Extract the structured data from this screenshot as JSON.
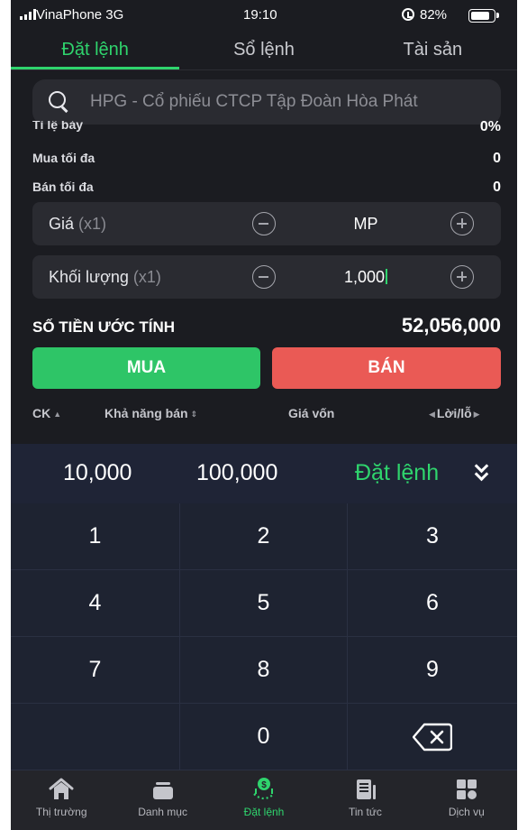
{
  "status_bar": {
    "carrier": "VinaPhone 3G",
    "time": "19:10",
    "battery_text": "82%",
    "battery_level": 0.82
  },
  "tabs": [
    {
      "label": "Đặt lệnh",
      "active": true
    },
    {
      "label": "Sổ lệnh",
      "active": false
    },
    {
      "label": "Tài sản",
      "active": false
    }
  ],
  "search": {
    "placeholder": "HPG - Cổ phiếu CTCP Tập Đoàn Hòa Phát",
    "icon": "search-icon"
  },
  "info_rows": [
    {
      "label": "Tỉ lệ bảy",
      "value": "0%"
    },
    {
      "label": "Mua tối đa",
      "value": "0"
    },
    {
      "label": "Bán tối đa",
      "value": "0"
    }
  ],
  "price_field": {
    "label": "Giá",
    "multiplier": "(x1)",
    "value": "MP"
  },
  "volume_field": {
    "label": "Khối lượng",
    "multiplier": "(x1)",
    "value": "1,000"
  },
  "estimate": {
    "label": "SỐ TIỀN ƯỚC TÍNH",
    "value": "52,056,000"
  },
  "actions": {
    "buy": "MUA",
    "sell": "BÁN"
  },
  "table_header": {
    "ck": "CK",
    "can_sell": "Khả năng bán",
    "cost": "Giá vốn",
    "pnl": "Lời/lỗ"
  },
  "keypad": {
    "quick": [
      "10,000",
      "100,000"
    ],
    "order_label": "Đặt lệnh",
    "keys": [
      "1",
      "2",
      "3",
      "4",
      "5",
      "6",
      "7",
      "8",
      "9",
      "",
      "0",
      "backspace"
    ]
  },
  "bottom_nav": [
    {
      "label": "Thị trường",
      "icon": "home-icon",
      "active": false
    },
    {
      "label": "Danh mục",
      "icon": "portfolio-icon",
      "active": false
    },
    {
      "label": "Đặt lệnh",
      "icon": "order-icon",
      "active": true
    },
    {
      "label": "Tin tức",
      "icon": "news-icon",
      "active": false
    },
    {
      "label": "Dịch vụ",
      "icon": "services-icon",
      "active": false
    }
  ],
  "colors": {
    "accent": "#2fd46d",
    "buy": "#2ec567",
    "sell": "#ea5a55",
    "background": "#1b1c21",
    "keypad": "#1e2331"
  }
}
